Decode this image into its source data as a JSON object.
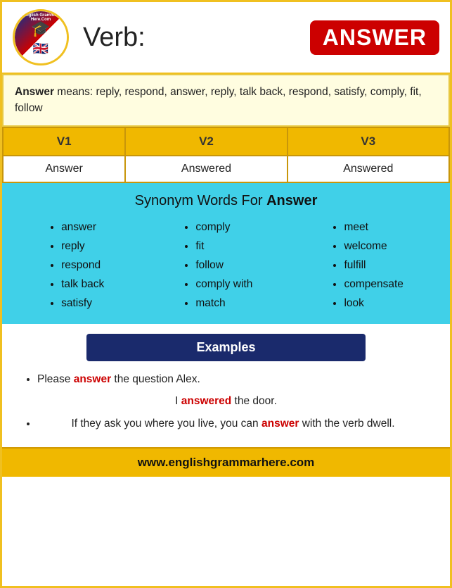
{
  "header": {
    "logo_top_text": "English Grammar Here.Com",
    "title": "Verb:",
    "verb_badge": "ANSWER"
  },
  "means": {
    "label": "Answer",
    "text": " means: reply, respond, answer, reply, talk back, respond, satisfy, comply, fit, follow"
  },
  "vforms": {
    "headers": [
      "V1",
      "V2",
      "V3"
    ],
    "row": [
      "Answer",
      "Answered",
      "Answered"
    ]
  },
  "synonyms": {
    "title": "Synonym Words For ",
    "title_word": "Answer",
    "col1": [
      "answer",
      "reply",
      "respond",
      "talk back",
      "satisfy"
    ],
    "col2": [
      "comply",
      "fit",
      "follow",
      "comply with",
      "match"
    ],
    "col3": [
      "meet",
      "welcome",
      "fulfill",
      "compensate",
      "look"
    ]
  },
  "examples_header": "Examples",
  "examples": [
    {
      "text_before": "Please ",
      "highlight": "answer",
      "text_after": " the question Alex.",
      "center": false
    },
    {
      "text_before": "I ",
      "highlight": "answered",
      "text_after": " the door.",
      "center": true
    },
    {
      "text_before": "If they ask you where you live, you can ",
      "highlight": "answer",
      "text_after": " with the verb dwell.",
      "center": true,
      "multiline": true
    }
  ],
  "footer": {
    "url": "www.englishgrammarhere.com"
  }
}
